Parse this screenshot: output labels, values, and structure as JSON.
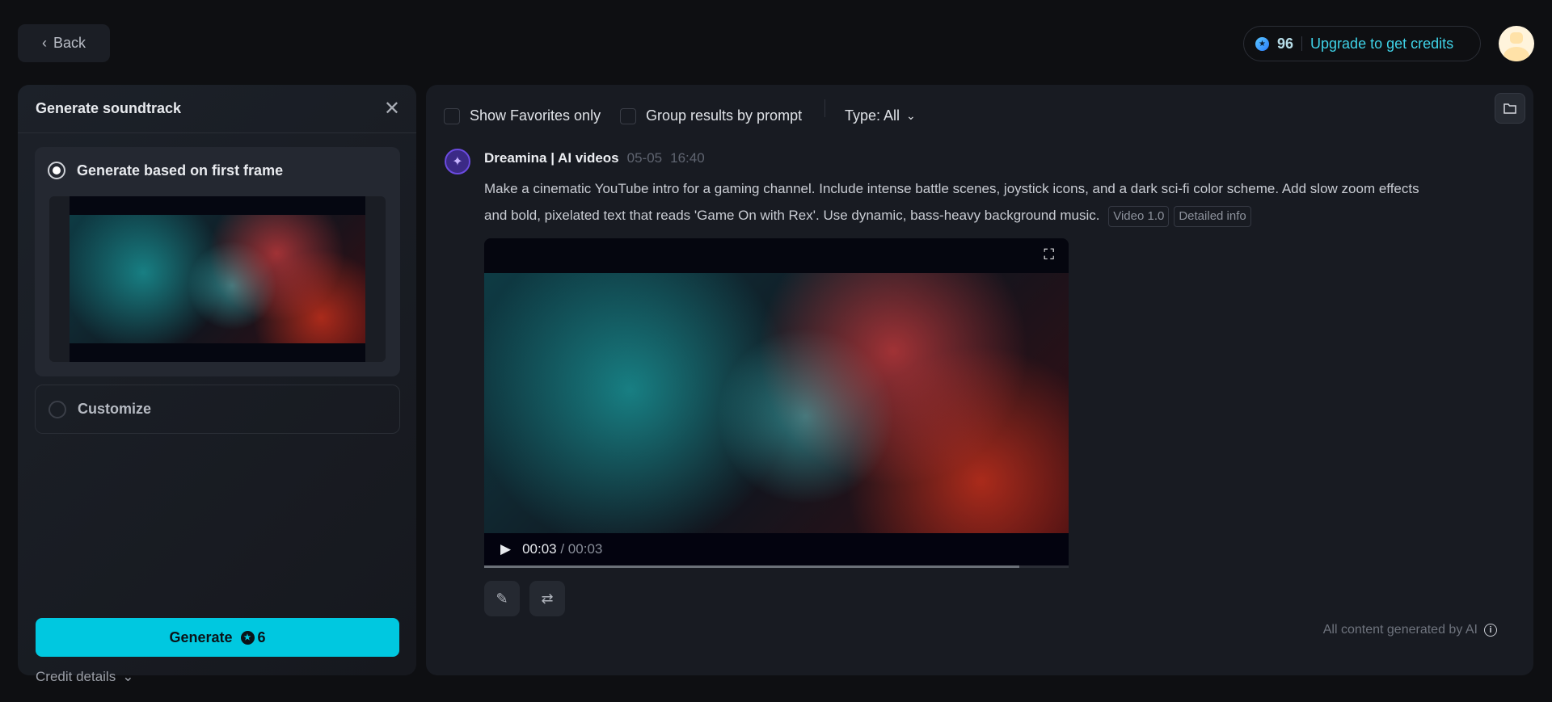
{
  "header": {
    "back_label": "Back",
    "credits": "96",
    "upgrade_label": "Upgrade to get credits"
  },
  "soundtrack_panel": {
    "title": "Generate soundtrack",
    "options": [
      {
        "label": "Generate based on first frame",
        "selected": true
      },
      {
        "label": "Customize",
        "selected": false
      }
    ],
    "credit_details_label": "Credit details",
    "generate_label": "Generate",
    "generate_cost": "6"
  },
  "toolbar": {
    "favorites_label": "Show Favorites only",
    "group_label": "Group results by prompt",
    "type_label": "Type: All"
  },
  "result": {
    "author": "Dreamina | AI videos",
    "date": "05-05",
    "time": "16:40",
    "prompt": "Make a cinematic YouTube intro for a gaming channel. Include intense battle scenes, joystick icons, and a dark sci-fi color scheme. Add slow zoom effects and bold, pixelated text that reads 'Game On with Rex'. Use dynamic, bass-heavy background music.",
    "tags": [
      "Video 1.0",
      "Detailed info"
    ],
    "video": {
      "current_time": "00:03",
      "duration": "/ 00:03",
      "progress_percent": 91.5
    }
  },
  "footer": {
    "ai_notice": "All content generated by AI"
  },
  "colors": {
    "accent": "#00c8e0",
    "link": "#3fd3e8",
    "background": "#0e0f12",
    "panel": "#181b22"
  }
}
